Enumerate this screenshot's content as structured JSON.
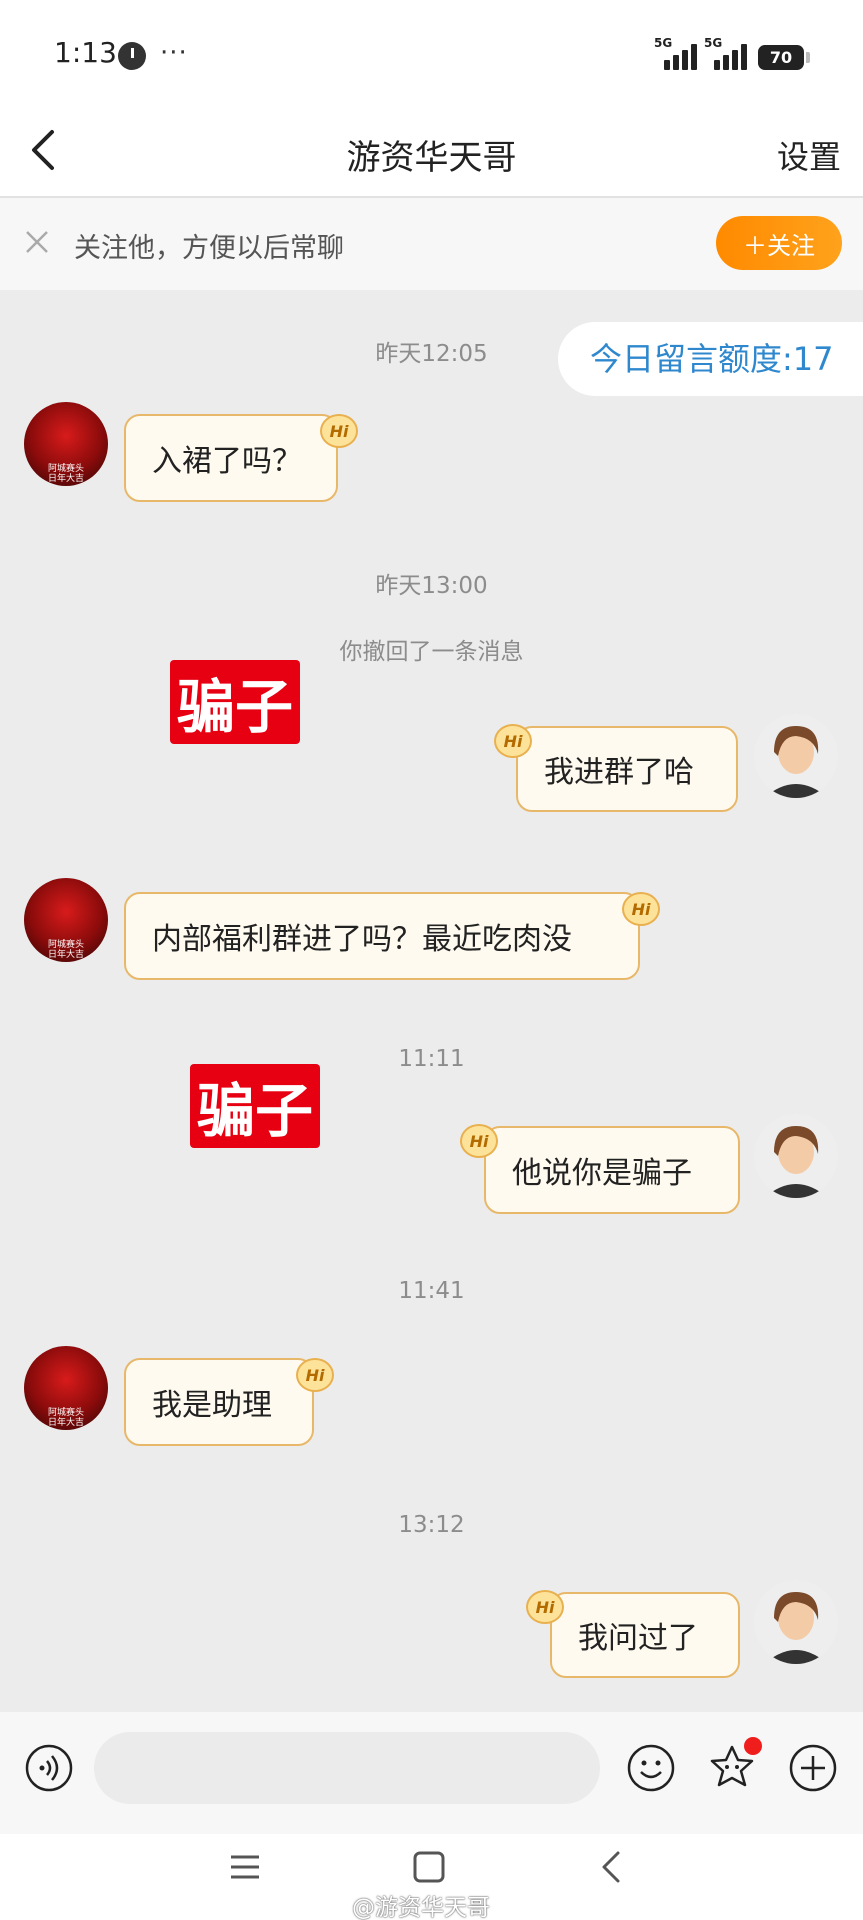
{
  "status_bar": {
    "time": "1:13",
    "more": "···",
    "signal1_label": "5G",
    "signal2_label": "5G",
    "battery": "70"
  },
  "header": {
    "title": "游资华天哥",
    "settings_label": "设置"
  },
  "follow_bar": {
    "text": "关注他，方便以后常聊",
    "button_label": "＋关注"
  },
  "quota_label": "今日留言额度:17",
  "avatar_caption": "阿城赛头\n日年大吉",
  "badge_label": "Hi",
  "messages": [
    {
      "kind": "timestamp",
      "text": "昨天12:05"
    },
    {
      "kind": "incoming",
      "text": "入裙了吗？"
    },
    {
      "kind": "timestamp",
      "text": "昨天13:00"
    },
    {
      "kind": "system",
      "text": "你撤回了一条消息"
    },
    {
      "kind": "annotation",
      "text": "骗子"
    },
    {
      "kind": "outgoing",
      "text": "我进群了哈"
    },
    {
      "kind": "incoming",
      "text": "内部福利群进了吗？最近吃肉没"
    },
    {
      "kind": "timestamp",
      "text": "11:11"
    },
    {
      "kind": "annotation",
      "text": "骗子"
    },
    {
      "kind": "outgoing",
      "text": "他说你是骗子"
    },
    {
      "kind": "timestamp",
      "text": "11:41"
    },
    {
      "kind": "incoming",
      "text": "我是助理"
    },
    {
      "kind": "timestamp",
      "text": "13:12"
    },
    {
      "kind": "outgoing",
      "text": "我问过了"
    }
  ],
  "input_bar": {
    "placeholder": "",
    "icons": [
      "voice-icon",
      "emoji-icon",
      "sticker-icon",
      "plus-icon"
    ]
  },
  "nav_bar": {
    "icons": [
      "menu-icon",
      "home-icon",
      "back-icon"
    ]
  },
  "watermark": "@游资华天哥",
  "colors": {
    "accent_orange": "#ff8a00",
    "bubble_border": "#e8b86a",
    "bubble_fill": "#fffaf0",
    "quota_text": "#2f88ce",
    "scam_label": "#e60012",
    "chat_bg": "#ececec"
  }
}
